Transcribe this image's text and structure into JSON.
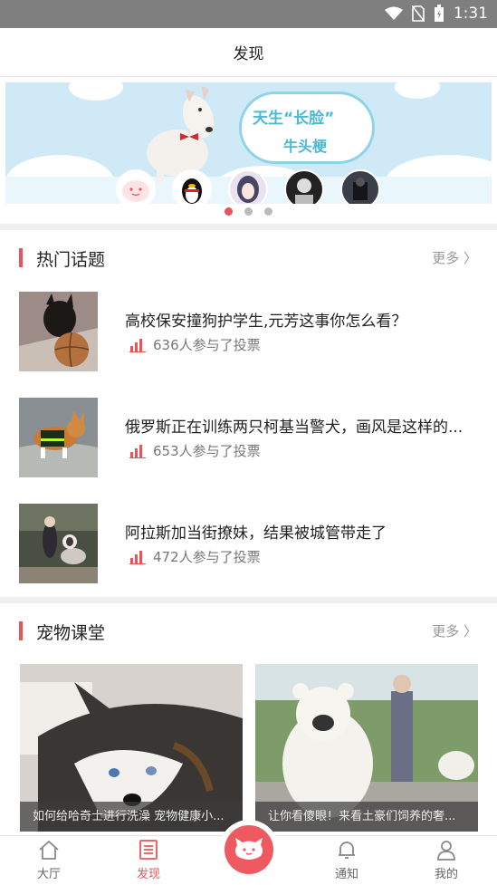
{
  "statusbar": {
    "time": "1:31"
  },
  "header": {
    "title": "发现"
  },
  "banner": {
    "line1": "天生“长脸”",
    "line2": "牛头梗"
  },
  "hot_topics": {
    "title": "热门话题",
    "more": "更多",
    "items": [
      {
        "title": "高校保安撞狗护学生,元芳这事你怎么看？",
        "meta": "636人参与了投票"
      },
      {
        "title": "俄罗斯正在训练两只柯基当警犬，画风是这样的...",
        "meta": "653人参与了投票"
      },
      {
        "title": "阿拉斯加当街撩妹，结果被城管带走了",
        "meta": "472人参与了投票"
      }
    ]
  },
  "pet_class": {
    "title": "宠物课堂",
    "more": "更多",
    "cards": [
      {
        "caption": "如何给哈奇士进行洗澡 宠物健康小..."
      },
      {
        "caption": "让你看傻眼！来看土豪们饲养的奢..."
      }
    ]
  },
  "tabbar": {
    "items": [
      {
        "label": "大厅",
        "icon": "home-icon"
      },
      {
        "label": "发现",
        "icon": "discover-icon"
      },
      {
        "label": "通知",
        "icon": "bell-icon"
      },
      {
        "label": "我的",
        "icon": "user-icon"
      }
    ]
  },
  "colors": {
    "accent": "#e9545a",
    "banner_sky": "#cfe9f6"
  }
}
